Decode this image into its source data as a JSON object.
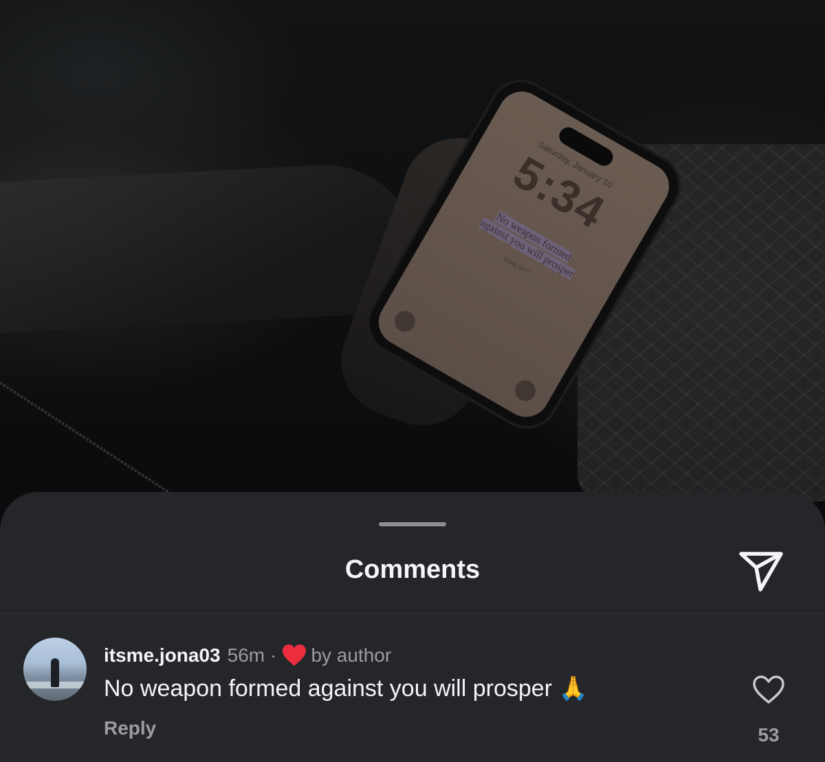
{
  "photo": {
    "lockscreen_date": "Saturday, January 10",
    "lockscreen_time": "5:34",
    "verse_line1": "No weapon formed",
    "verse_line2": "against you will prosper",
    "verse_ref": "Isaiah 54:17"
  },
  "sheet": {
    "title": "Comments"
  },
  "comment": {
    "username": "itsme.jona03",
    "time_ago": "56m",
    "separator": "·",
    "liked_by": "by author",
    "text": "No weapon formed against you will prosper 🙏",
    "reply_label": "Reply",
    "like_count": "53"
  },
  "colors": {
    "sheet_bg": "#25262a",
    "author_heart": "#ed2e3f",
    "secondary_text": "#9c9da3"
  },
  "icons": {
    "share": "paper-plane-icon",
    "like": "heart-outline-icon",
    "author_like": "heart-filled-icon"
  }
}
